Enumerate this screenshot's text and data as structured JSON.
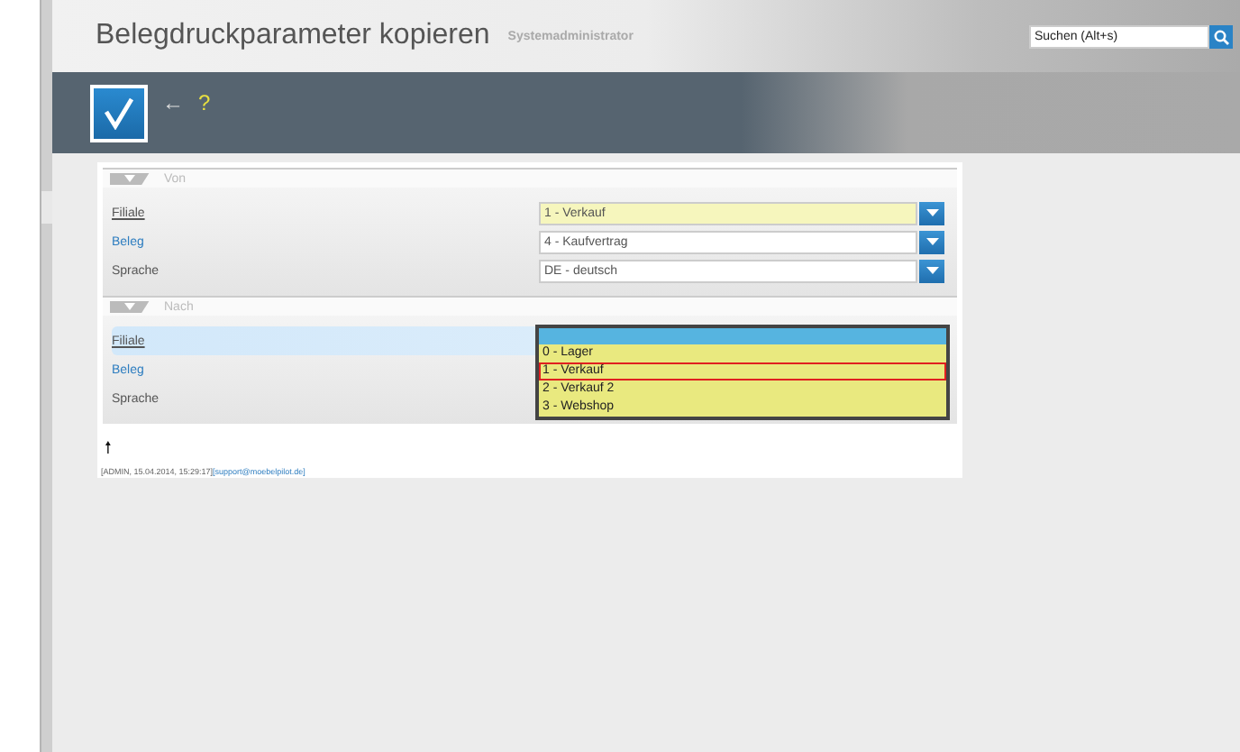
{
  "header": {
    "title": "Belegdruckparameter kopieren",
    "user": "Systemadministrator",
    "search": {
      "placeholder": "Suchen (Alt+s)"
    }
  },
  "toolbar": {
    "back": "←",
    "help": "?"
  },
  "sections": [
    {
      "title": "Von",
      "expanded": true,
      "rows": [
        {
          "label": "Filiale",
          "kind": "required",
          "value": "1 - Verkauf",
          "focused": true
        },
        {
          "label": "Beleg",
          "kind": "link",
          "value": "4 - Kaufvertrag",
          "focused": false
        },
        {
          "label": "Sprache",
          "kind": "plain",
          "value": "DE - deutsch",
          "focused": false
        }
      ]
    },
    {
      "title": "Nach",
      "expanded": true,
      "rows": [
        {
          "label": "Filiale",
          "kind": "required",
          "focused": true
        },
        {
          "label": "Beleg",
          "kind": "link",
          "focused": false
        },
        {
          "label": "Sprache",
          "kind": "plain",
          "focused": false
        }
      ]
    }
  ],
  "dropdown": {
    "options": [
      {
        "label": "0 - Lager",
        "selected": false
      },
      {
        "label": "1 - Verkauf",
        "selected": true
      },
      {
        "label": "2 - Verkauf 2",
        "selected": false
      },
      {
        "label": "3 - Webshop",
        "selected": false
      }
    ]
  },
  "footer": {
    "arrow": "🠕",
    "info": "[ADMIN, 15.04.2014, 15:29:17]",
    "link": "[support@moebelpilot.de]"
  }
}
